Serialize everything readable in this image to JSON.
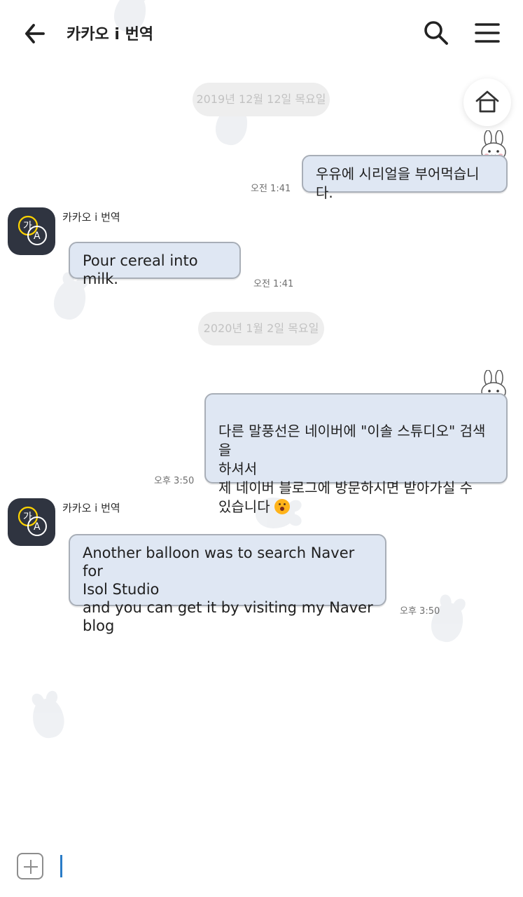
{
  "header": {
    "title": "카카오 i 번역"
  },
  "date_dividers": [
    {
      "label": "2019년 12월 12일 목요일"
    },
    {
      "label": "2020년 1월 2일 목요일"
    }
  ],
  "messages": [
    {
      "side": "right",
      "text": "우유에 시리얼을 부어먹습니다.",
      "time": "오전 1:41"
    },
    {
      "side": "left",
      "sender": "카카오 i 번역",
      "text": "Pour cereal into milk.",
      "time": "오전 1:41"
    },
    {
      "side": "right",
      "text": "다른 말풍선은 네이버에 \"이솔 스튜디오\" 검색을\n하셔서\n제 네이버 블로그에 방문하시면 받아가실 수\n있습니다",
      "time": "오후 3:50"
    },
    {
      "side": "left",
      "sender": "카카오 i 번역",
      "text": "Another balloon was to search Naver for\nIsol Studio\nand you can get it by visiting my Naver blog",
      "time": "오후 3:50"
    }
  ],
  "composer": {
    "placeholder": ""
  },
  "colors": {
    "bubble_fill": "#dfe7f3",
    "bubble_border": "#a8aeb7",
    "date_pill_bg": "#eeeeee",
    "avatar_bg": "#2f3440",
    "accent_caret": "#2a7cc7"
  },
  "icons": {
    "back": "arrow-left-icon",
    "search": "search-icon",
    "menu": "hamburger-menu-icon",
    "home": "home-icon",
    "add": "plus-square-icon",
    "bunny": "bunny-sticker-icon",
    "avatar": "translate-avatar-icon",
    "emoji": "surprised-face-emoji"
  }
}
